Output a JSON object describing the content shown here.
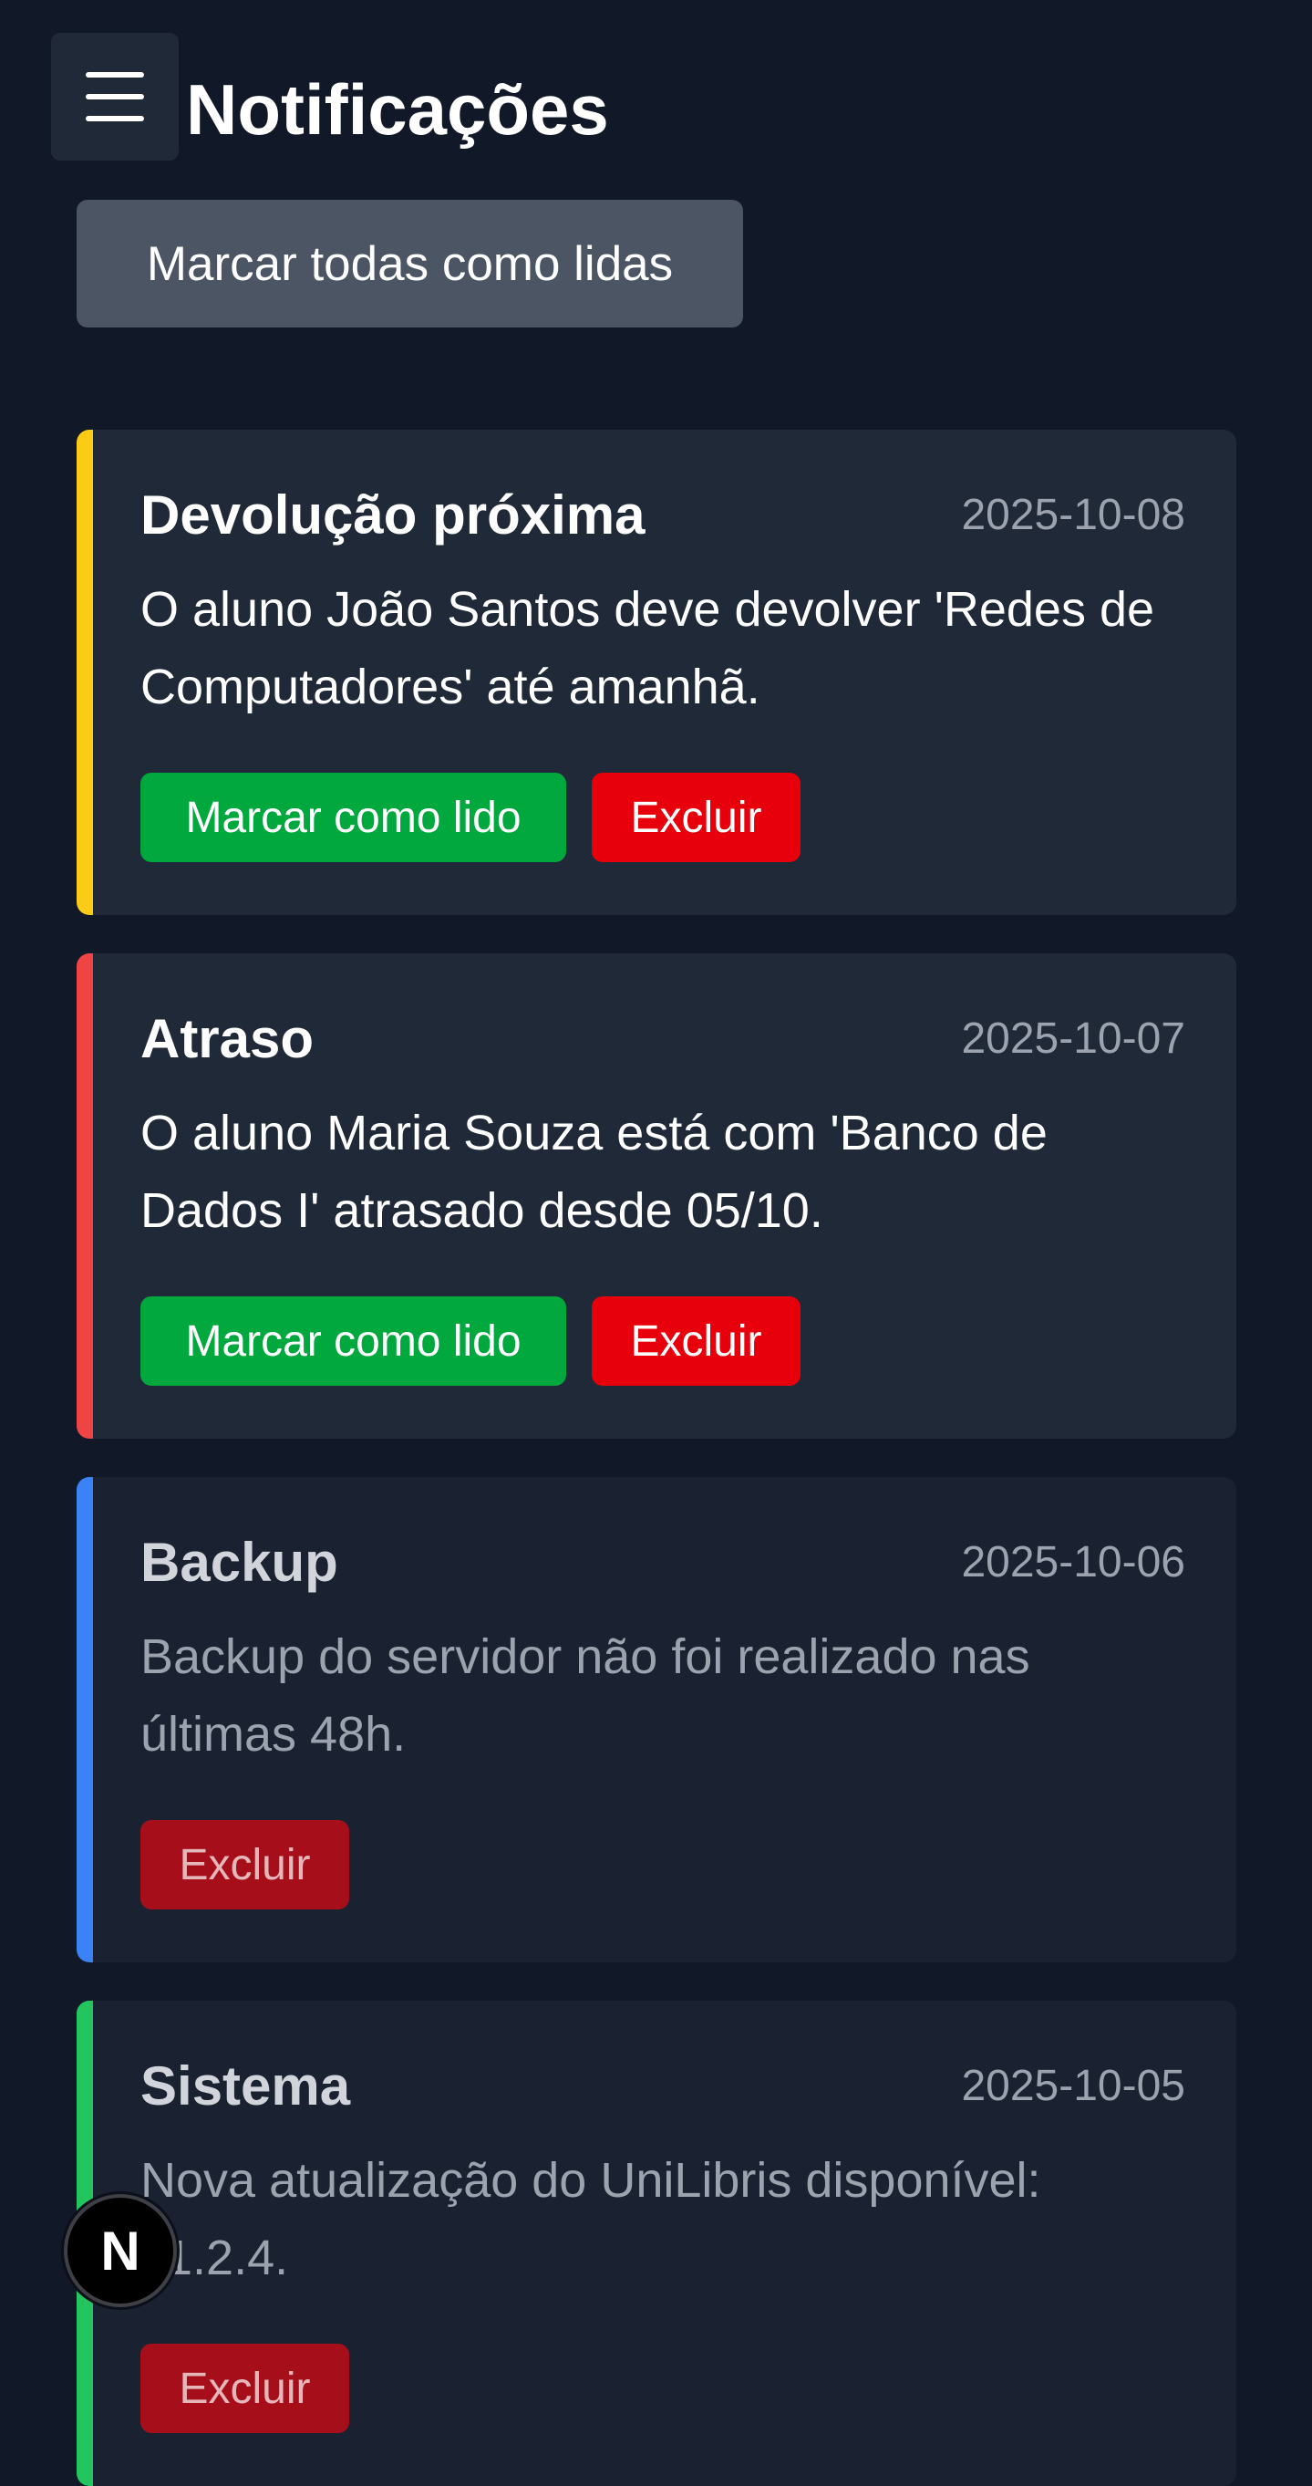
{
  "header": {
    "title": "Notificações",
    "menu_icon": "hamburger-icon"
  },
  "toolbar": {
    "mark_all_label": "Marcar todas como lidas"
  },
  "colors": {
    "warning": "#facc15",
    "danger": "#ef4444",
    "info": "#3b82f6",
    "success": "#22c55e",
    "mark_read_button": "#00a83d",
    "delete_button": "#e7000b"
  },
  "notifications": [
    {
      "title": "Devolução próxima",
      "date": "2025-10-08",
      "message": "O aluno João Santos deve devolver 'Redes de Computadores' até amanhã.",
      "mark_read_label": "Marcar como lido",
      "delete_label": "Excluir",
      "read": false,
      "accent": "#facc15"
    },
    {
      "title": "Atraso",
      "date": "2025-10-07",
      "message": "O aluno Maria Souza está com 'Banco de Dados I' atrasado desde 05/10.",
      "mark_read_label": "Marcar como lido",
      "delete_label": "Excluir",
      "read": false,
      "accent": "#ef4444"
    },
    {
      "title": "Backup",
      "date": "2025-10-06",
      "message": "Backup do servidor não foi realizado nas últimas 48h.",
      "delete_label": "Excluir",
      "read": true,
      "accent": "#3b82f6"
    },
    {
      "title": "Sistema",
      "date": "2025-10-05",
      "message": "Nova atualização do UniLibris disponível: v1.2.4.",
      "delete_label": "Excluir",
      "read": true,
      "accent": "#22c55e"
    }
  ],
  "dev_indicator": {
    "label": "N",
    "icon": "nextjs-logo-icon"
  }
}
